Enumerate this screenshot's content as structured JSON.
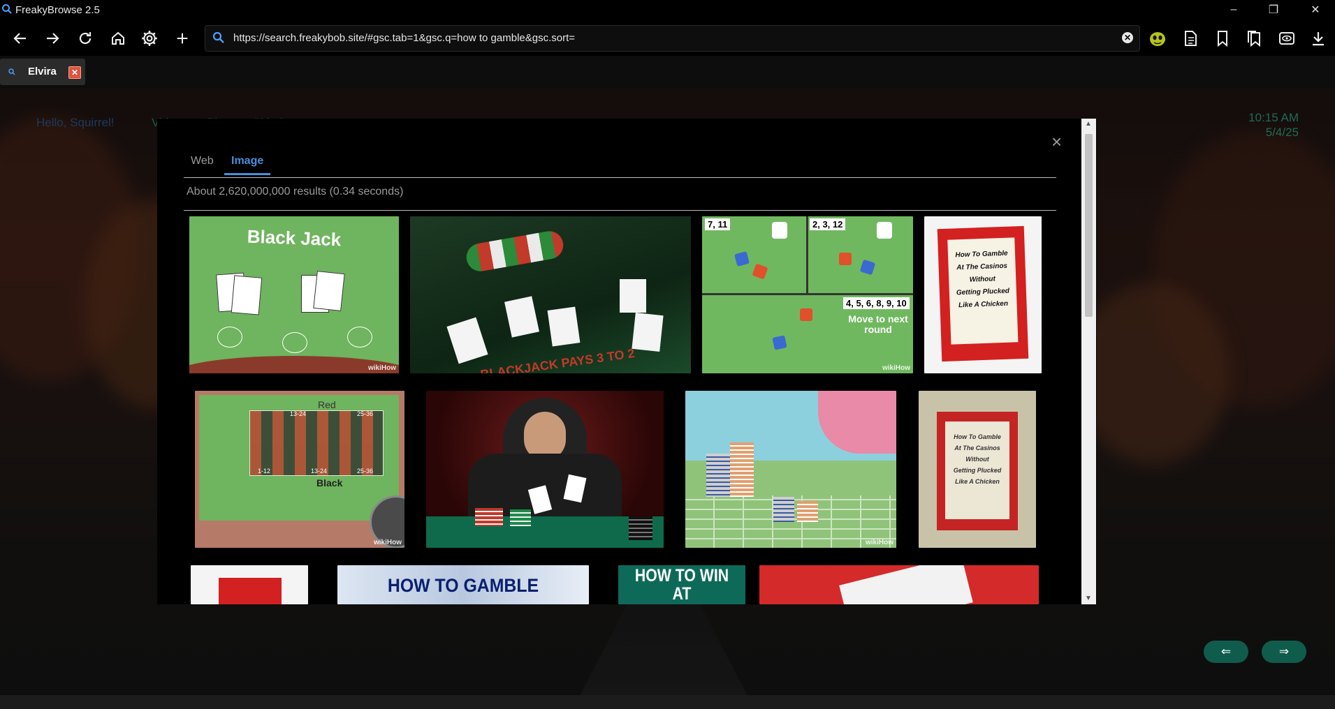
{
  "window": {
    "title": "FreakyBrowse 2.5"
  },
  "toolbar": {
    "url": "https://search.freakybob.site/#gsc.tab=1&gsc.q=how to gamble&gsc.sort="
  },
  "tab": {
    "label": "Elvira"
  },
  "page": {
    "greeting": "Hello, Squirrel!",
    "nav": [
      "Videos",
      "Blog",
      "Github"
    ],
    "time": "10:15 AM",
    "date": "5/4/25",
    "prev_label": "⇐",
    "next_label": "⇒"
  },
  "search": {
    "tabs": [
      "Web",
      "Image"
    ],
    "active_tab": "Image",
    "result_count": "About 2,620,000,000 results (0.34 seconds)",
    "close_label": "×",
    "images": {
      "blackjack_title": "Black Jack",
      "wikihow": "wikiHow",
      "dice_tl": "7, 11",
      "dice_tr": "2, 3, 12",
      "dice_b": "4, 5, 6, 8, 9, 10",
      "dice_move": "Move to next round",
      "book_lines": [
        "How To Gamble",
        "At The Casinos",
        "Without",
        "Getting Plucked",
        "Like A Chicken"
      ],
      "roulette_red": "Red",
      "roulette_black": "Black",
      "roulette_labels": [
        "13-24",
        "25-36",
        "1-12",
        "13-24",
        "25-36"
      ],
      "banner1": "HOW TO GAMBLE",
      "banner2": "HOW TO WIN AT GAMBLING"
    }
  }
}
